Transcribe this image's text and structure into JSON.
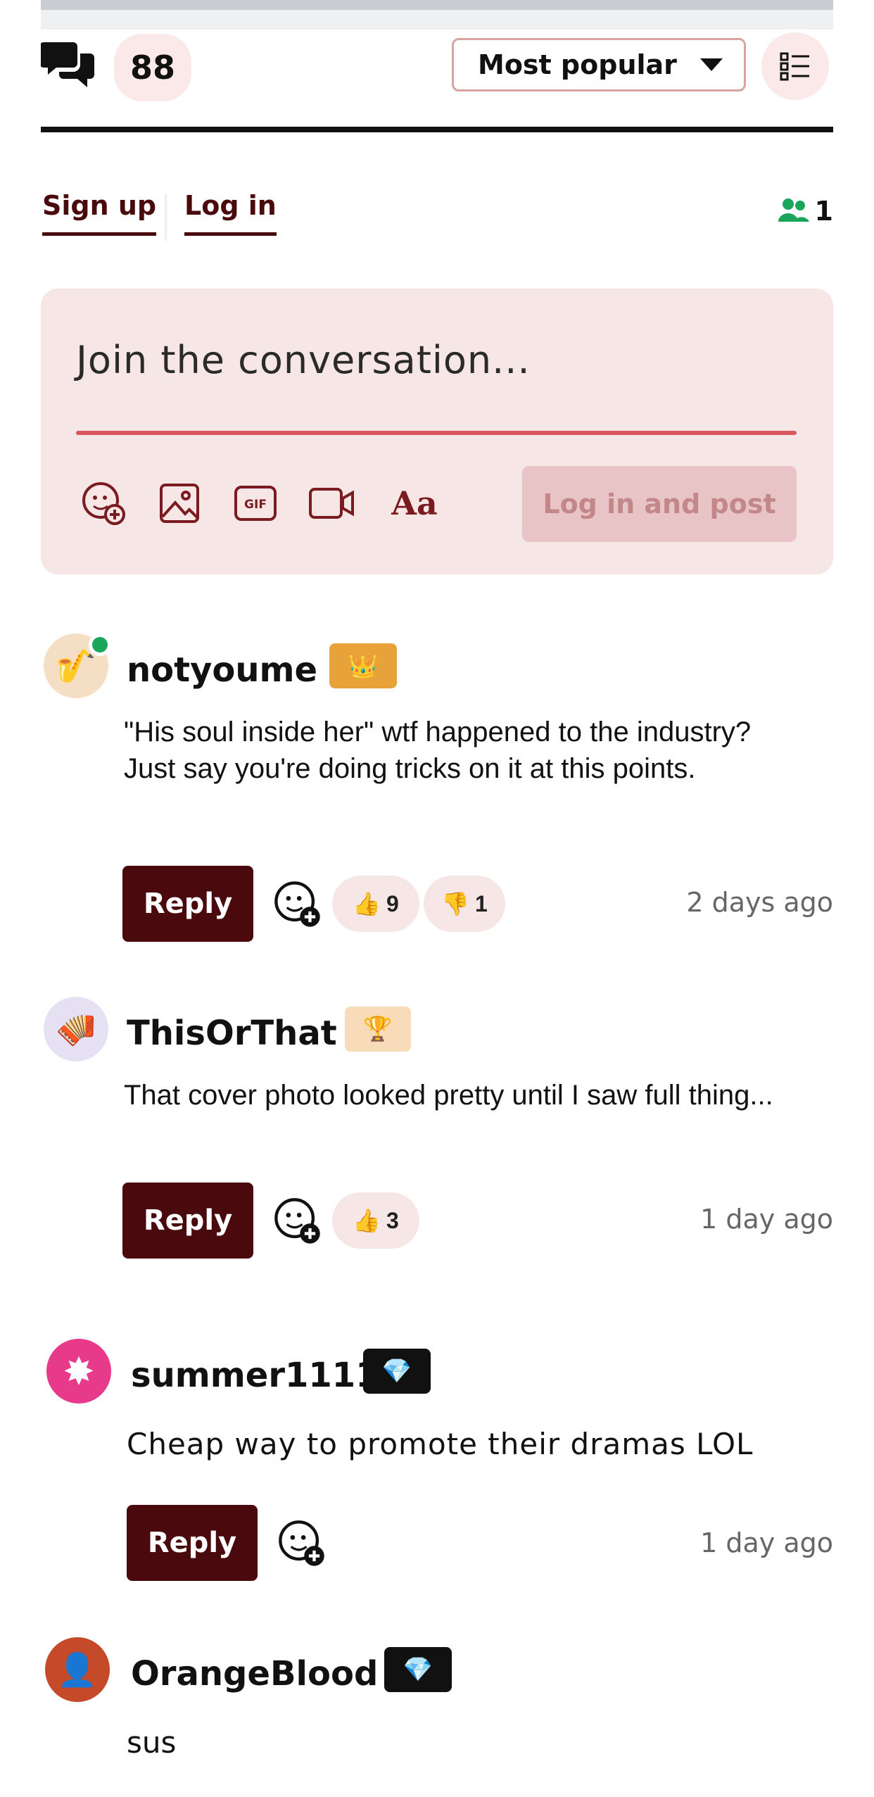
{
  "header": {
    "comment_count": "88",
    "sort_label": "Most popular",
    "comments_icon": "speech-bubbles-icon",
    "list_icon": "list-icon"
  },
  "auth": {
    "signup_label": "Sign up",
    "login_label": "Log in",
    "online_count": "1",
    "online_icon": "users-icon"
  },
  "composer": {
    "placeholder": "Join the conversation...",
    "tools": [
      "emoji-add-icon",
      "image-icon",
      "gif-icon",
      "video-icon",
      "text-format-icon"
    ],
    "text_format_label": "Aa",
    "post_label": "Log in and post"
  },
  "comments": [
    {
      "username": "notyoume",
      "badge": "👑",
      "avatar": "🎷",
      "online": true,
      "text": "\"His soul inside her\" wtf happened to the industry? Just say you're doing tricks on it at this points.",
      "reply_label": "Reply",
      "upvotes": "9",
      "downvotes": "1",
      "time": "2 days ago"
    },
    {
      "username": "ThisOrThat",
      "badge": "🏆",
      "avatar": "🪗",
      "online": false,
      "text": "That cover photo looked pretty until I saw full thing...",
      "reply_label": "Reply",
      "upvotes": "3",
      "time": "1 day ago"
    },
    {
      "username": "summer1111",
      "badge": "💎",
      "avatar": "✸",
      "online": false,
      "text": "Cheap way to promote their dramas LOL",
      "reply_label": "Reply",
      "time": "1 day ago"
    },
    {
      "username": "OrangeBlood",
      "badge": "💎",
      "avatar": "👤",
      "online": false,
      "text": "sus"
    }
  ],
  "colors": {
    "brand": "#4a0a0d",
    "composer_bg": "#f7e6e6",
    "accent_line": "#d9585e",
    "online_green": "#1aa65a"
  }
}
